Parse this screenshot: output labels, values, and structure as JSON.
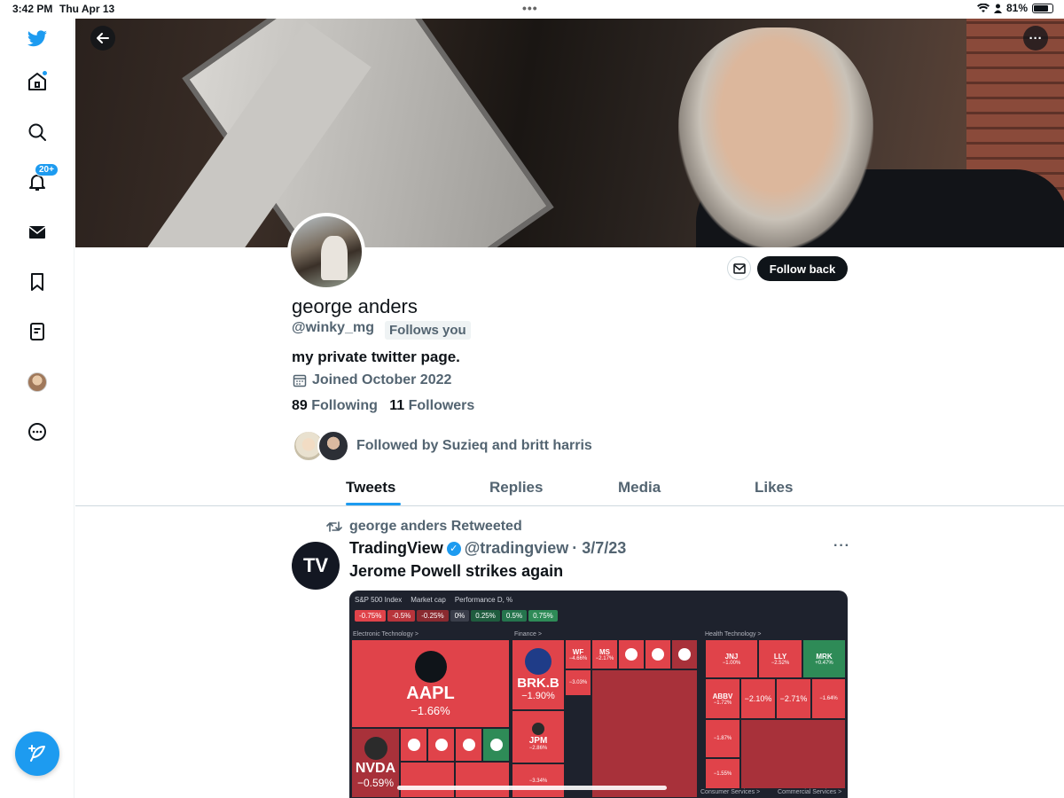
{
  "status_bar": {
    "time": "3:42 PM",
    "date": "Thu Apr 13",
    "battery": "81%",
    "battery_level": 0.81
  },
  "sidebar": {
    "items": [
      {
        "name": "twitter-logo-icon"
      },
      {
        "name": "home-icon"
      },
      {
        "name": "search-icon"
      },
      {
        "name": "notifications-icon",
        "badge": "20+"
      },
      {
        "name": "messages-icon"
      },
      {
        "name": "bookmarks-icon"
      },
      {
        "name": "lists-icon"
      },
      {
        "name": "profile-avatar"
      },
      {
        "name": "more-icon"
      }
    ],
    "compose": "compose-tweet-icon"
  },
  "profile": {
    "display_name": "george anders",
    "handle": "@winky_mg",
    "follows_you": "Follows you",
    "bio": "my private twitter page.",
    "joined": "Joined October 2022",
    "following_count": "89",
    "following_label": "Following",
    "followers_count": "11",
    "followers_label": "Followers",
    "followed_by": "Followed by Suzieq and britt harris",
    "follow_back": "Follow back"
  },
  "tabs": [
    "Tweets",
    "Replies",
    "Media",
    "Likes"
  ],
  "active_tab": "Tweets",
  "tweet": {
    "retweeted_by": "george anders Retweeted",
    "author_name": "TradingView",
    "author_handle": "@tradingview",
    "date": "· 3/7/23",
    "text": "Jerome Powell strikes again",
    "avatar_text": "TV"
  },
  "heatmap": {
    "title": "S&P 500 Index",
    "size_label": "Market cap",
    "color_label": "Performance D, %",
    "legend": [
      "-0.75%",
      "-0.5%",
      "-0.25%",
      "0%",
      "0.25%",
      "0.5%",
      "0.75%"
    ],
    "sectors": [
      "Electronic Technology >",
      "Finance >",
      "Health Technology >"
    ],
    "bottom_sectors": [
      "Consumer Services >",
      "Commercial Services >"
    ],
    "tiles": {
      "aapl": {
        "ticker": "AAPL",
        "change": "−1.66%"
      },
      "nvda": {
        "ticker": "NVDA",
        "change": "−0.59%"
      },
      "brkb": {
        "ticker": "BRK.B",
        "change": "−1.90%"
      },
      "jpm": {
        "ticker": "JPM",
        "change": "−2.86%"
      },
      "jnj": {
        "ticker": "JNJ",
        "change": "−1.00%"
      },
      "lly": {
        "ticker": "LLY",
        "change": "−2.52%"
      },
      "mrk": {
        "ticker": "MRK",
        "change": "+0.47%"
      },
      "abbv": {
        "ticker": "ABBV",
        "change": "−1.72%"
      },
      "pct210": {
        "ticker": "",
        "change": "−2.10%"
      },
      "pct271": {
        "ticker": "",
        "change": "−2.71%"
      },
      "pct164": {
        "ticker": "",
        "change": "−1.64%"
      },
      "ms": {
        "ticker": "MS",
        "change": "−2.17%"
      },
      "wf": {
        "ticker": "WF",
        "change": "−4.66%"
      },
      "c187": {
        "ticker": "",
        "change": "−1.87%"
      },
      "c155": {
        "ticker": "",
        "change": "−1.55%"
      },
      "c303": {
        "ticker": "",
        "change": "−3.03%"
      },
      "c334": {
        "ticker": "",
        "change": "−3.34%"
      }
    }
  }
}
